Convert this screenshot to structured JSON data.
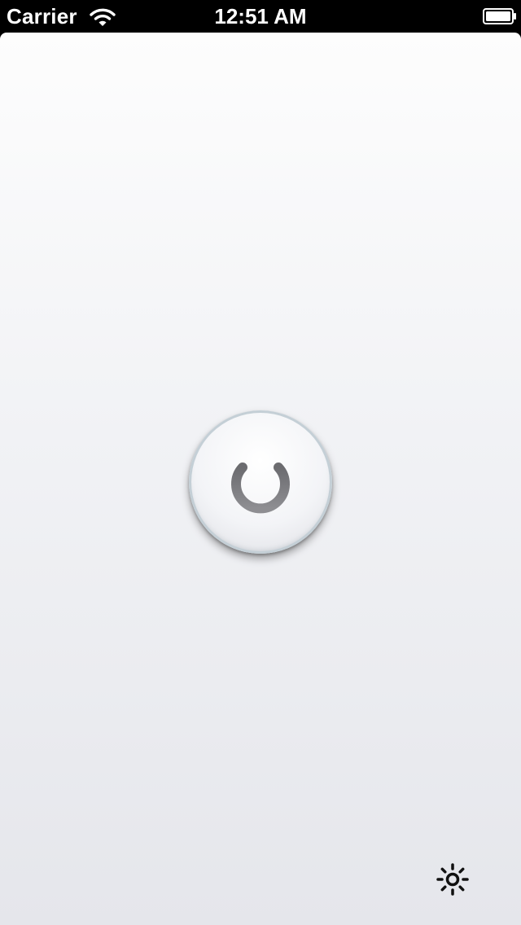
{
  "status_bar": {
    "carrier": "Carrier",
    "time": "12:51 AM",
    "wifi_icon": "wifi-icon",
    "battery_icon": "battery-icon",
    "battery_level": 1.0
  },
  "main": {
    "power_button_icon": "power-icon",
    "settings_icon": "brightness-icon"
  },
  "colors": {
    "status_bar_bg": "#000000",
    "status_text": "#ffffff",
    "background_top": "#fdfdfd",
    "background_bottom": "#e5e6eb",
    "power_symbol": "#7d7d80",
    "button_rim": "#c4cfd6"
  }
}
